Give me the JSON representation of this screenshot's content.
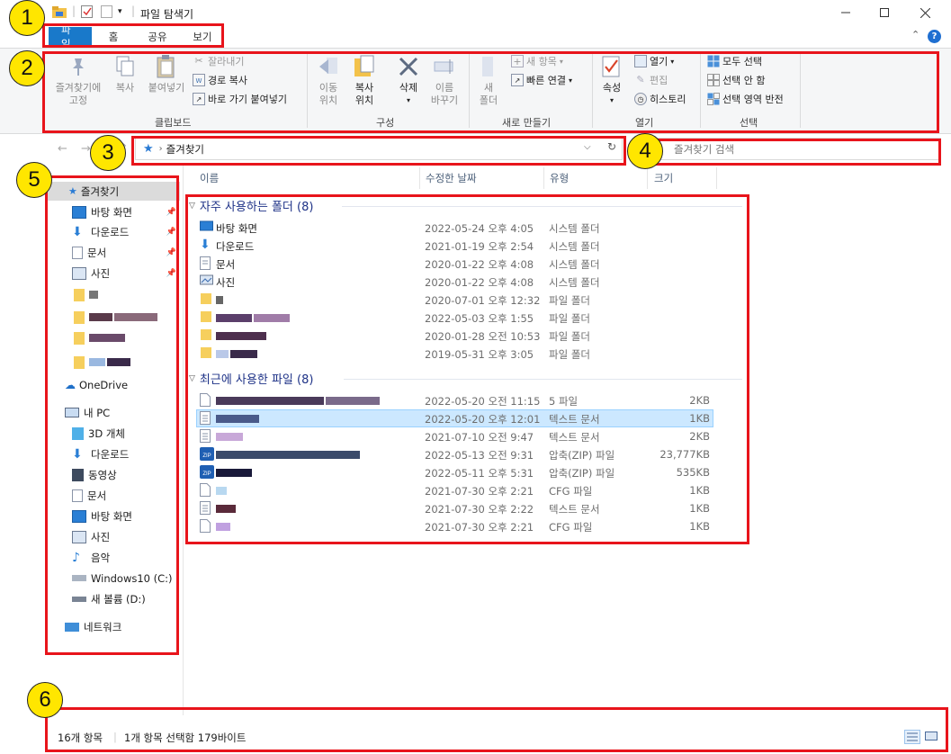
{
  "titlebar": {
    "title": "파일 탐색기",
    "qa_separator": "|"
  },
  "tabs": [
    "파일",
    "홈",
    "공유",
    "보기"
  ],
  "ribbon": {
    "clipboard": {
      "pin_label_1": "즐겨찾기에",
      "pin_label_2": "고정",
      "copy": "복사",
      "paste": "붙여넣기",
      "cut": "잘라내기",
      "copy_path": "경로 복사",
      "paste_shortcut": "바로 가기 붙여넣기",
      "group": "클립보드"
    },
    "organize": {
      "move_1": "이동",
      "move_2": "위치",
      "copyto_1": "복사",
      "copyto_2": "위치",
      "delete": "삭제",
      "rename_1": "이름",
      "rename_2": "바꾸기",
      "group": "구성"
    },
    "new": {
      "new_folder_1": "새",
      "new_folder_2": "폴더",
      "new_item": "새 항목",
      "easy_access": "빠른 연결",
      "group": "새로 만들기"
    },
    "open": {
      "properties": "속성",
      "open": "열기",
      "edit": "편집",
      "history": "히스토리",
      "group": "열기"
    },
    "select": {
      "select_all": "모두 선택",
      "select_none": "선택 안 함",
      "invert": "선택 영역 반전",
      "group": "선택"
    }
  },
  "address": {
    "path": "즐겨찾기",
    "search_placeholder": "즐겨찾기 검색"
  },
  "navpane": {
    "quick_access": "즐겨찾기",
    "quick_items": [
      "바탕 화면",
      "다운로드",
      "문서",
      "사진"
    ],
    "onedrive": "OneDrive",
    "thispc": "내 PC",
    "pc_items": [
      "3D 개체",
      "다운로드",
      "동영상",
      "문서",
      "바탕 화면",
      "사진",
      "음악",
      "Windows10 (C:)",
      "새 볼륨 (D:)"
    ],
    "network": "네트워크"
  },
  "columns": {
    "name": "이름",
    "date": "수정한 날짜",
    "type": "유형",
    "size": "크기"
  },
  "frequent": {
    "header": "자주 사용하는 폴더 (8)",
    "rows": [
      {
        "name": "바탕 화면",
        "date": "2022-05-24 오후 4:05",
        "type": "시스템 폴더",
        "icon": "desktop-icon"
      },
      {
        "name": "다운로드",
        "date": "2021-01-19 오후 2:54",
        "type": "시스템 폴더",
        "icon": "download-icon"
      },
      {
        "name": "문서",
        "date": "2020-01-22 오후 4:08",
        "type": "시스템 폴더",
        "icon": "documents-icon"
      },
      {
        "name": "사진",
        "date": "2020-01-22 오후 4:08",
        "type": "시스템 폴더",
        "icon": "pictures-icon"
      },
      {
        "name": "",
        "date": "2020-07-01 오후 12:32",
        "type": "파일 폴더",
        "icon": "folder-icon"
      },
      {
        "name": "",
        "date": "2022-05-03 오후 1:55",
        "type": "파일 폴더",
        "icon": "folder-icon"
      },
      {
        "name": "",
        "date": "2020-01-28 오전 10:53",
        "type": "파일 폴더",
        "icon": "folder-icon"
      },
      {
        "name": "",
        "date": "2019-05-31 오후 3:05",
        "type": "파일 폴더",
        "icon": "folder-icon"
      }
    ]
  },
  "recent": {
    "header": "최근에 사용한 파일 (8)",
    "rows": [
      {
        "date": "2022-05-20 오전 11:15",
        "type": "5 파일",
        "size": "2KB",
        "icon": "file-icon"
      },
      {
        "date": "2022-05-20 오후 12:01",
        "type": "텍스트 문서",
        "size": "1KB",
        "icon": "text-file-icon",
        "selected": true
      },
      {
        "date": "2021-07-10 오전 9:47",
        "type": "텍스트 문서",
        "size": "2KB",
        "icon": "text-file-icon"
      },
      {
        "date": "2022-05-13 오전 9:31",
        "type": "압축(ZIP) 파일",
        "size": "23,777KB",
        "icon": "zip-icon"
      },
      {
        "date": "2022-05-11 오후 5:31",
        "type": "압축(ZIP) 파일",
        "size": "535KB",
        "icon": "zip-icon"
      },
      {
        "date": "2021-07-30 오후 2:21",
        "type": "CFG 파일",
        "size": "1KB",
        "icon": "file-icon"
      },
      {
        "date": "2021-07-30 오후 2:22",
        "type": "텍스트 문서",
        "size": "1KB",
        "icon": "text-file-icon"
      },
      {
        "date": "2021-07-30 오후 2:21",
        "type": "CFG 파일",
        "size": "1KB",
        "icon": "file-icon"
      }
    ]
  },
  "status": {
    "count": "16개 항목",
    "selection": "1개 항목 선택함 179바이트"
  },
  "annotations": [
    "1",
    "2",
    "3",
    "4",
    "5",
    "6"
  ],
  "colors": {
    "accent": "#1979ca",
    "annotation_red": "#e8141b",
    "badge_yellow": "#ffe600",
    "selected_row": "#cce8ff"
  }
}
